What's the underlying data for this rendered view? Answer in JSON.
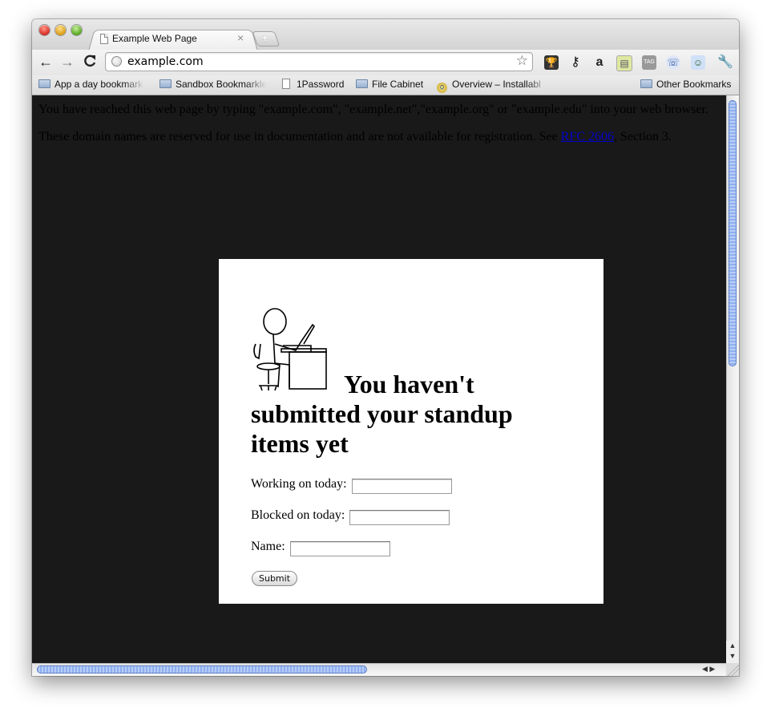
{
  "browser": {
    "tab": {
      "title": "Example Web Page",
      "close_glyph": "×"
    },
    "new_tab_glyph": "+",
    "nav": {
      "back": "←",
      "forward": "→",
      "reload": "C"
    },
    "address_bar": {
      "value": "example.com",
      "bookmark_star": "☆"
    },
    "extensions": [
      "trophy-icon",
      "key-icon",
      "amazon-icon",
      "note-icon",
      "tag-icon",
      "chat-icon",
      "ghost-icon",
      "wrench-icon"
    ],
    "extension_glyphs": {
      "trophy": "🏆",
      "key": "⚷",
      "amazon": "a",
      "note": "▤",
      "tag": "TAG",
      "chat": "☏",
      "ghost": "☺",
      "wrench": "🔧"
    },
    "bookmarks": [
      {
        "label": "App a day bookmark",
        "icon": "folder"
      },
      {
        "label": "Sandbox Bookmarkle",
        "icon": "folder"
      },
      {
        "label": "1Password",
        "icon": "page"
      },
      {
        "label": "File Cabinet",
        "icon": "folder"
      },
      {
        "label": "Overview – Installabl",
        "icon": "coin"
      }
    ],
    "other_bookmarks": "Other Bookmarks"
  },
  "page": {
    "para1": "You have reached this web page by typing \"example.com\", \"example.net\",\"example.org\" or \"example.edu\" into your web browser.",
    "para2_before": "These domain names are reserved for use in documentation and are not available for registration. See ",
    "para2_link": "RFC 2606",
    "para2_after": ", Section 3."
  },
  "modal": {
    "heading": "You haven't submitted your standup items yet",
    "fields": [
      {
        "label": "Working on today:",
        "value": ""
      },
      {
        "label": "Blocked on today:",
        "value": ""
      },
      {
        "label": "Name:",
        "value": ""
      }
    ],
    "submit_label": "Submit"
  },
  "colors": {
    "overlay_background": "#191919",
    "modal_background": "#ffffff",
    "link": "#0000cc",
    "scroll_thumb": "#8fb0f0"
  }
}
